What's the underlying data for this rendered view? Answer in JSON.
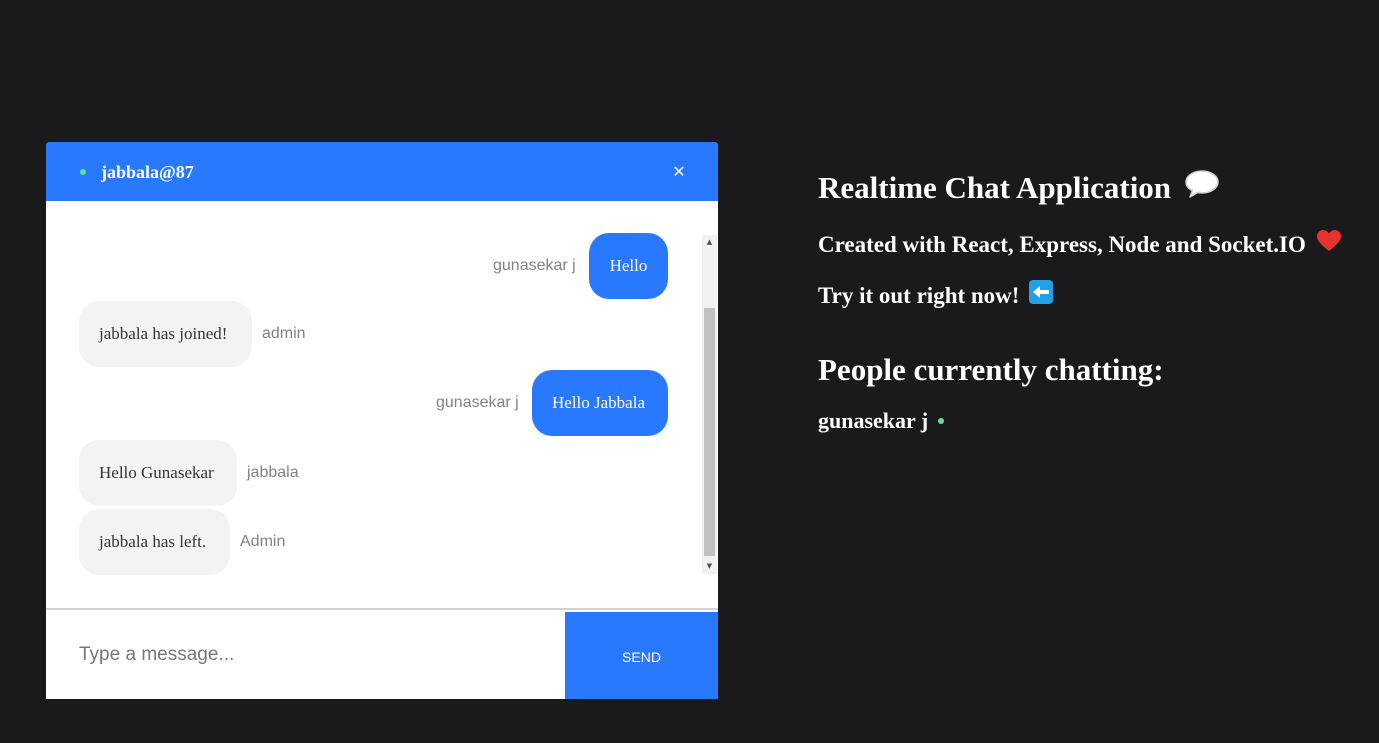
{
  "chat": {
    "room_name": "jabbala@87",
    "close_label": "✕",
    "messages": [
      {
        "text": "Hello",
        "sender": "gunasekar j",
        "own": true
      },
      {
        "text": "jabbala has joined!",
        "sender": "admin",
        "own": false
      },
      {
        "text": "Hello Jabbala",
        "sender": "gunasekar j",
        "own": true
      },
      {
        "text": "Hello Gunasekar",
        "sender": "jabbala",
        "own": false
      },
      {
        "text": "jabbala has left.",
        "sender": "Admin",
        "own": false
      }
    ],
    "input_placeholder": "Type a message...",
    "input_value": "",
    "send_label": "Send"
  },
  "info": {
    "title": "Realtime Chat Application",
    "created_with": "Created with React, Express, Node and Socket.IO",
    "try_it": "Try it out right now!",
    "people_title": "People currently chatting:",
    "people": [
      "gunasekar j"
    ]
  },
  "colors": {
    "accent": "#2979ff",
    "background": "#1a1a1d",
    "online": "#5ee19a",
    "bubble_other": "#f3f3f3",
    "heart": "#e8322d"
  },
  "icons": {
    "title_emoji": "speech-balloon-icon",
    "created_emoji": "red-heart-icon",
    "try_emoji": "left-arrow-icon",
    "online": "online-dot-icon"
  }
}
